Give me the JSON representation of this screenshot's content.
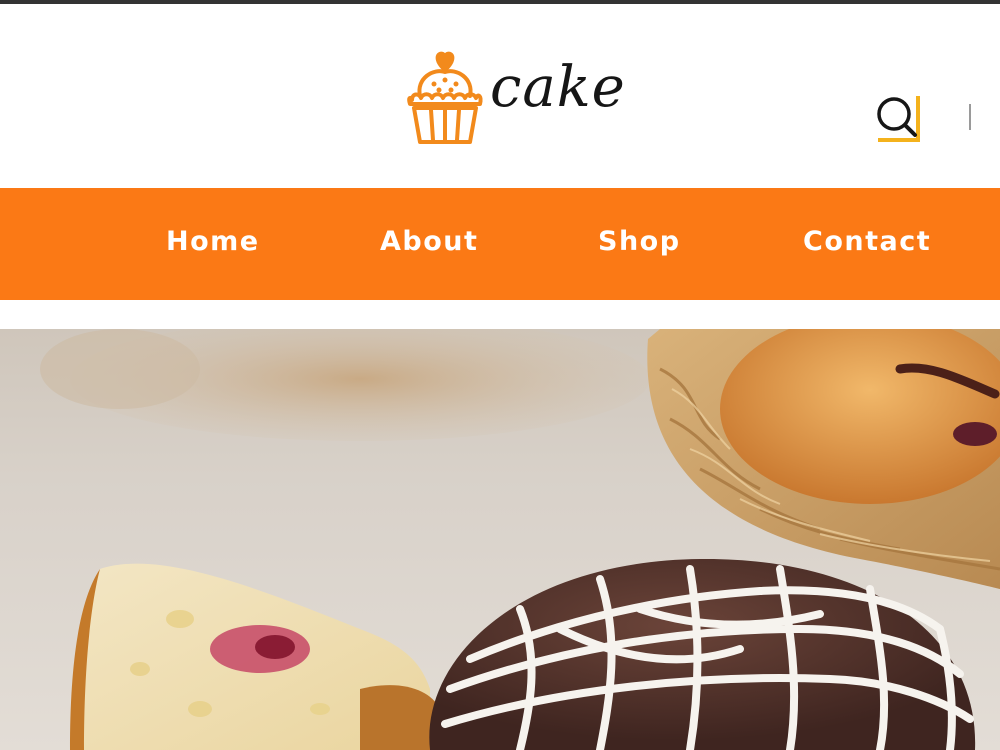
{
  "brand": {
    "name": "cake",
    "logo_icon": "cupcake-icon",
    "accent_color": "#fb7915"
  },
  "header": {
    "search_icon": "search-icon"
  },
  "nav": {
    "items": [
      {
        "label": "Home"
      },
      {
        "label": "About"
      },
      {
        "label": "Shop"
      },
      {
        "label": "Contact"
      }
    ]
  },
  "hero": {
    "image": "pastries-photo"
  }
}
